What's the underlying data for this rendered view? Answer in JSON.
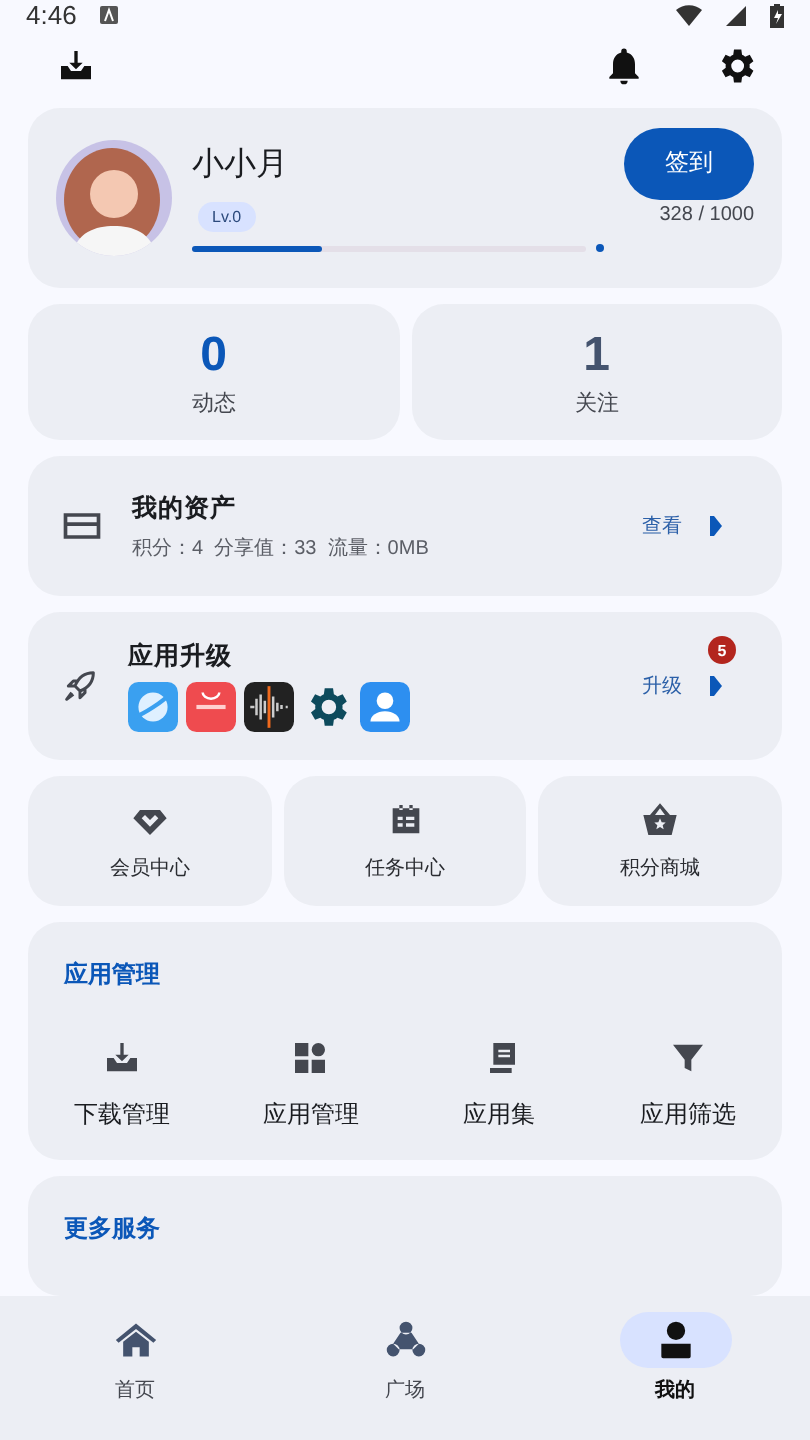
{
  "status_bar": {
    "time": "4:46"
  },
  "profile": {
    "name": "小小月",
    "level_badge": "Lv.0",
    "progress": {
      "level": 0.328,
      "reading": "328 / 1000"
    },
    "checkin_button": "签到"
  },
  "stats": [
    {
      "value": "0",
      "label": "动态",
      "active": true
    },
    {
      "value": "1",
      "label": "关注",
      "active": false
    }
  ],
  "assets": {
    "title": "我的资产",
    "detail": "积分：4  分享值：33  流量：0MB",
    "action": "查看"
  },
  "upgrade": {
    "title": "应用升级",
    "action": "升级",
    "badge": "5",
    "apps": [
      {
        "kind": "browser"
      },
      {
        "kind": "store"
      },
      {
        "kind": "recorder"
      },
      {
        "kind": "settings"
      },
      {
        "kind": "contacts"
      }
    ]
  },
  "shortcuts": [
    {
      "label": "会员中心",
      "kind": "vip"
    },
    {
      "label": "任务中心",
      "kind": "task"
    },
    {
      "label": "积分商城",
      "kind": "shop"
    }
  ],
  "app_management": {
    "title": "应用管理",
    "items": [
      {
        "label": "下载管理",
        "kind": "download"
      },
      {
        "label": "应用管理",
        "kind": "apps"
      },
      {
        "label": "应用集",
        "kind": "collection"
      },
      {
        "label": "应用筛选",
        "kind": "filter"
      }
    ]
  },
  "more_services": {
    "title": "更多服务"
  },
  "bottom_nav": [
    {
      "label": "首页",
      "kind": "home",
      "selected": false
    },
    {
      "label": "广场",
      "kind": "square",
      "selected": false
    },
    {
      "label": "我的",
      "kind": "me",
      "selected": true
    }
  ]
}
